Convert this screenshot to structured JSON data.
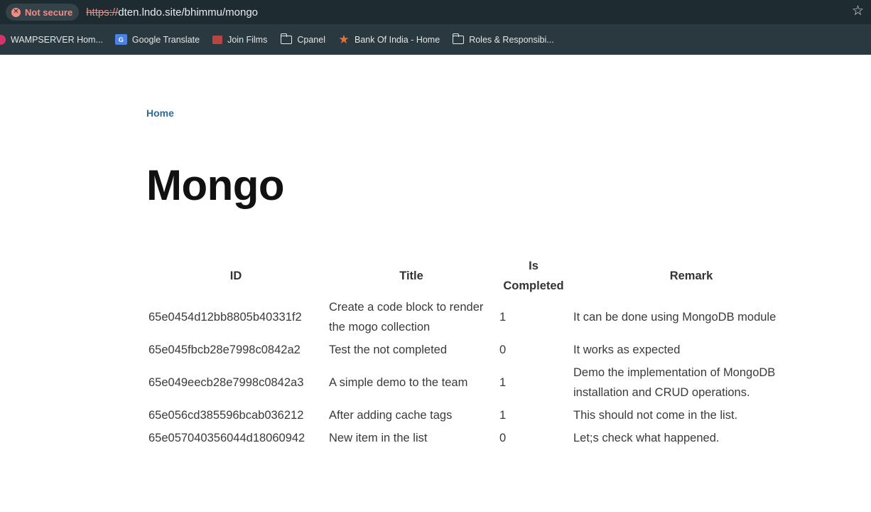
{
  "browser": {
    "security_label": "Not secure",
    "url_scheme": "https://",
    "url_rest": "dten.lndo.site/bhimmu/mongo",
    "bookmarks": [
      {
        "label": "WAMPSERVER Hom...",
        "icon": "wamp-icon"
      },
      {
        "label": "Google Translate",
        "icon": "translate-icon"
      },
      {
        "label": "Join Films",
        "icon": "film-icon"
      },
      {
        "label": "Cpanel",
        "icon": "folder-icon"
      },
      {
        "label": "Bank Of India - Home",
        "icon": "bank-icon"
      },
      {
        "label": "Roles & Responsibi...",
        "icon": "folder-icon"
      }
    ],
    "warning_glyph": "✕",
    "star_glyph": "☆"
  },
  "page": {
    "breadcrumb": "Home",
    "title": "Mongo"
  },
  "table": {
    "headers": {
      "id": "ID",
      "title": "Title",
      "is_completed": "Is Completed",
      "remark": "Remark"
    },
    "rows": [
      {
        "id": "65e0454d12bb8805b40331f2",
        "title": "Create a code block to render the mogo collection",
        "is_completed": "1",
        "remark": "It can be done using MongoDB module"
      },
      {
        "id": "65e045fbcb28e7998c0842a2",
        "title": "Test the not completed",
        "is_completed": "0",
        "remark": "It works as expected"
      },
      {
        "id": "65e049eecb28e7998c0842a3",
        "title": "A simple demo to the team",
        "is_completed": "1",
        "remark": "Demo the implementation of MongoDB installation and CRUD operations."
      },
      {
        "id": "65e056cd385596bcab036212",
        "title": "After adding cache tags",
        "is_completed": "1",
        "remark": "This should not come in the list."
      },
      {
        "id": "65e057040356044d18060942",
        "title": "New item in the list",
        "is_completed": "0",
        "remark": "Let;s check what happened."
      }
    ]
  }
}
